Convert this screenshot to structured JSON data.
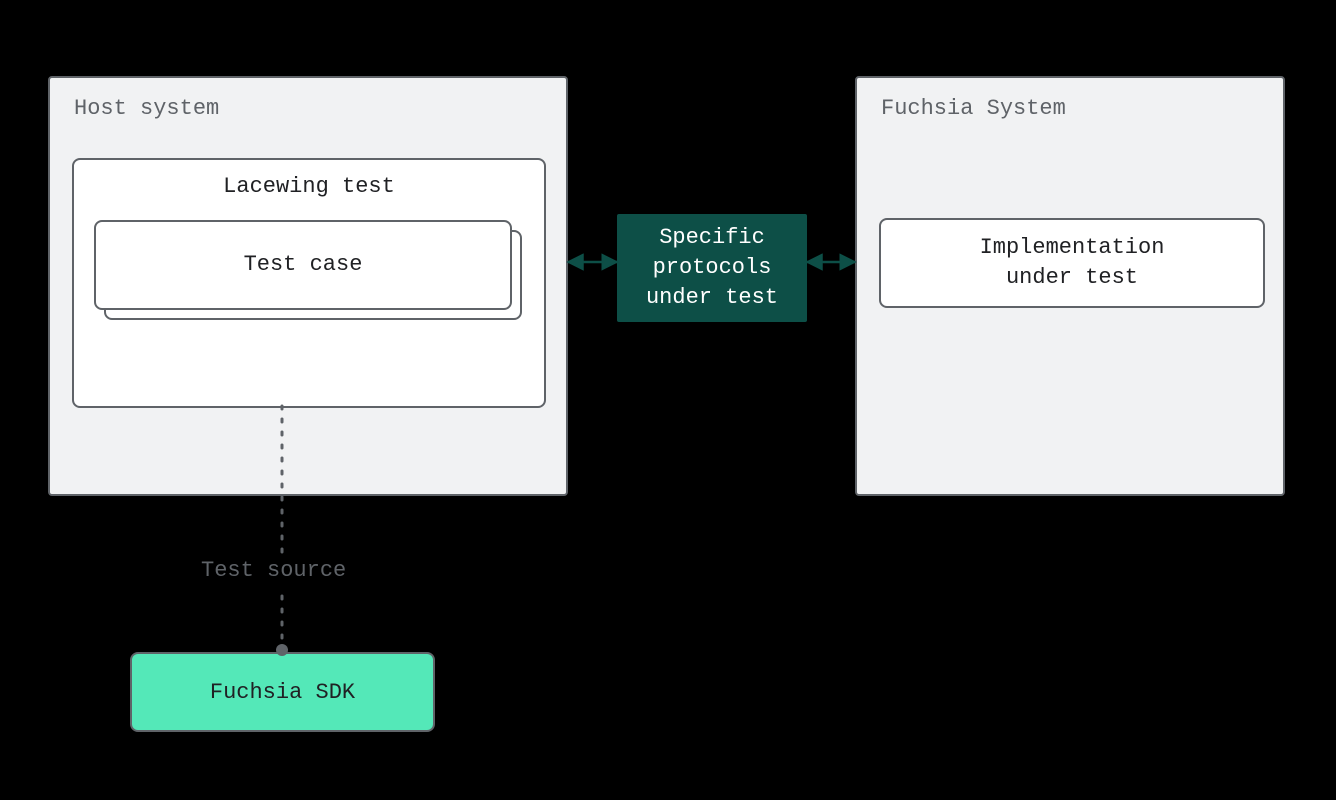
{
  "host_panel": {
    "title": "Host system"
  },
  "lacewing_panel": {
    "title": "Lacewing test"
  },
  "test_case": {
    "label": "Test case"
  },
  "protocols": {
    "line1": "Specific",
    "line2": "protocols",
    "line3": "under test"
  },
  "fuchsia_panel": {
    "title": "Fuchsia System"
  },
  "implementation": {
    "line1": "Implementation",
    "line2": "under test"
  },
  "test_source": {
    "label": "Test source"
  },
  "sdk": {
    "label": "Fuchsia SDK"
  }
}
